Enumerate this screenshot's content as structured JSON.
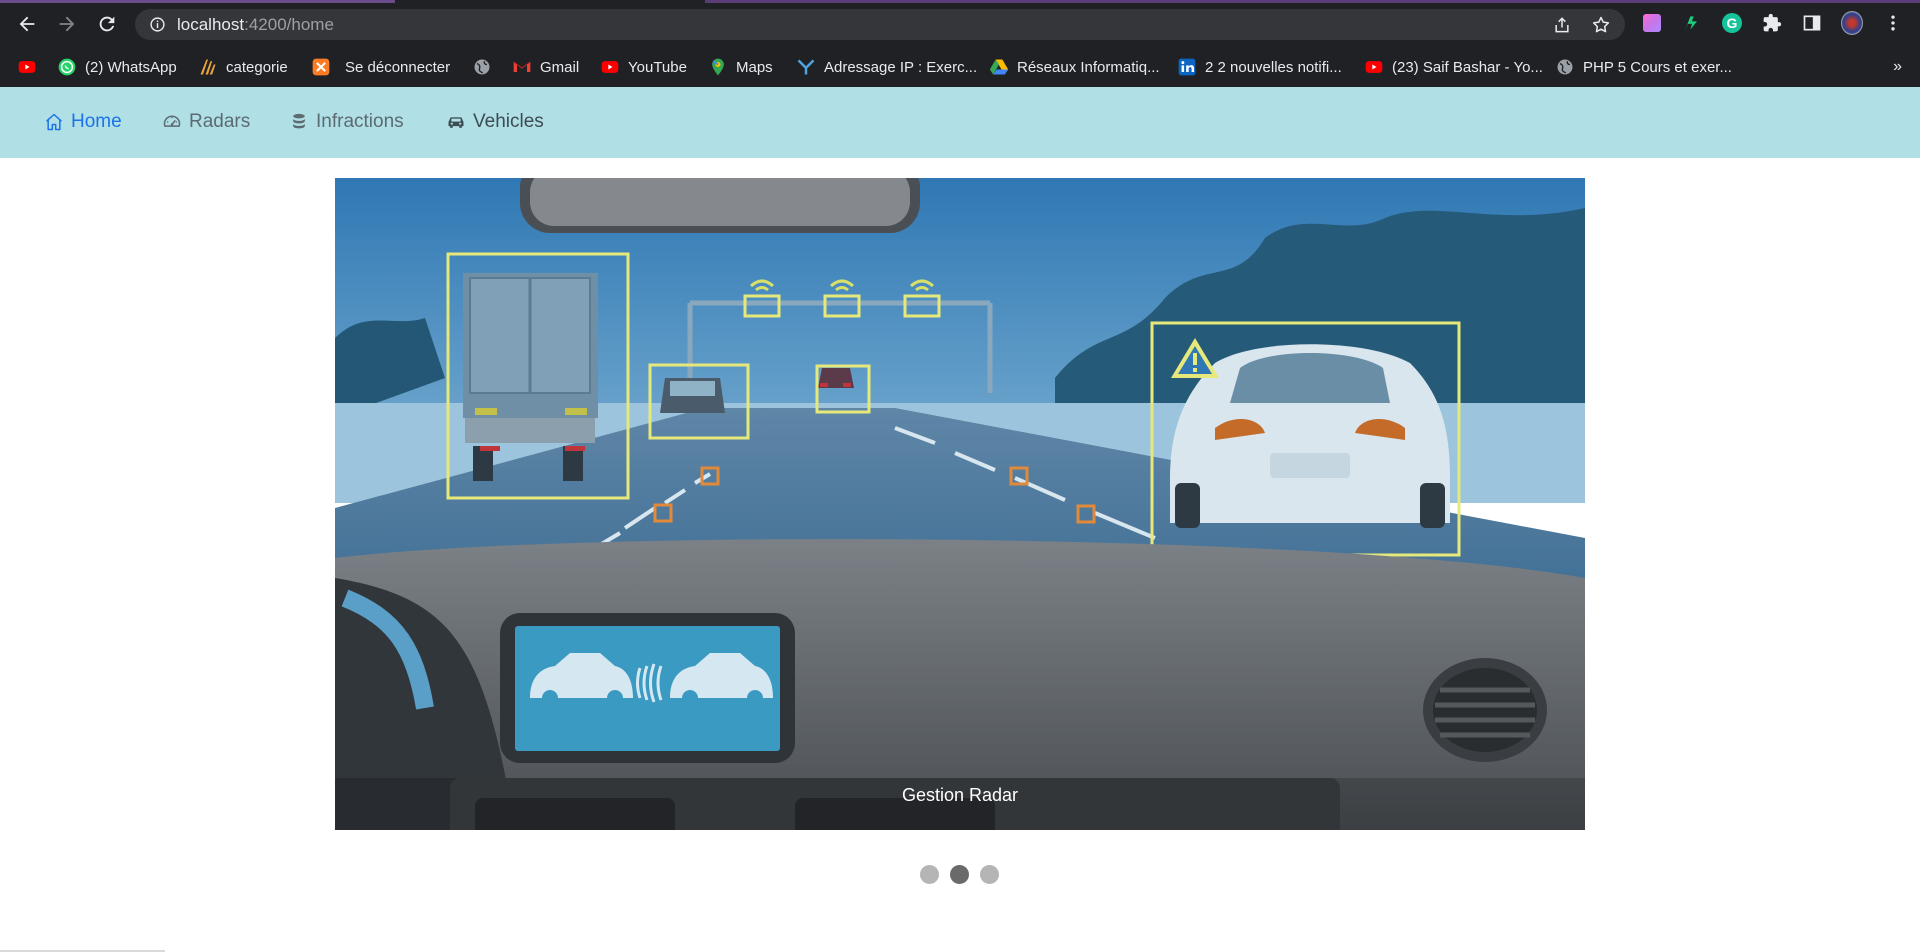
{
  "browser": {
    "url_host": "localhost",
    "url_path": ":4200/home",
    "icons": [
      "back-icon",
      "forward-icon",
      "reload-icon",
      "info-icon",
      "share-icon",
      "star-icon",
      "extensions-icon",
      "side-panel-icon",
      "menu-icon"
    ]
  },
  "bookmarks": [
    {
      "label": "",
      "icon": "youtube-icon",
      "color": "#ff0000"
    },
    {
      "label": "(2) WhatsApp",
      "icon": "whatsapp-icon",
      "color": "#25d366"
    },
    {
      "label": "categorie",
      "icon": "categorie-icon",
      "color": "#e8a33d"
    },
    {
      "label": "Se déconnecter",
      "icon": "xampp-icon",
      "color": "#fb7a24"
    },
    {
      "label": "",
      "icon": "globe-icon",
      "color": "#9aa0a6"
    },
    {
      "label": "Gmail",
      "icon": "gmail-icon",
      "color": "#ea4335"
    },
    {
      "label": "YouTube",
      "icon": "youtube-icon",
      "color": "#ff0000"
    },
    {
      "label": "Maps",
      "icon": "maps-icon",
      "color": "#34a853"
    },
    {
      "label": "Adressage IP : Exerc...",
      "icon": "bookmark-site-icon",
      "color": "#4fa3e0"
    },
    {
      "label": "Réseaux Informatiq...",
      "icon": "drive-icon",
      "color": "#fbbc04"
    },
    {
      "label": "2 2 nouvelles notifi...",
      "icon": "linkedin-icon",
      "color": "#0a66c2"
    },
    {
      "label": "(23) Saif Bashar - Yo...",
      "icon": "youtube-icon",
      "color": "#ff0000"
    },
    {
      "label": "PHP 5 Cours et exer...",
      "icon": "globe-icon",
      "color": "#9aa0a6"
    }
  ],
  "bookmarks_more": "»",
  "navbar": {
    "items": [
      {
        "label": "Home",
        "icon": "home-icon",
        "active": true
      },
      {
        "label": "Radars",
        "icon": "speedometer-icon",
        "active": false
      },
      {
        "label": "Infractions",
        "icon": "database-icon",
        "active": false
      },
      {
        "label": "Vehicles",
        "icon": "car-icon",
        "active": false
      }
    ]
  },
  "carousel": {
    "caption": "Gestion Radar",
    "slide_count": 3,
    "active_slide": 2
  },
  "colors": {
    "navbar_bg": "#b1dfe6",
    "nav_active": "#1a73e8",
    "chrome_bg": "#202124"
  }
}
